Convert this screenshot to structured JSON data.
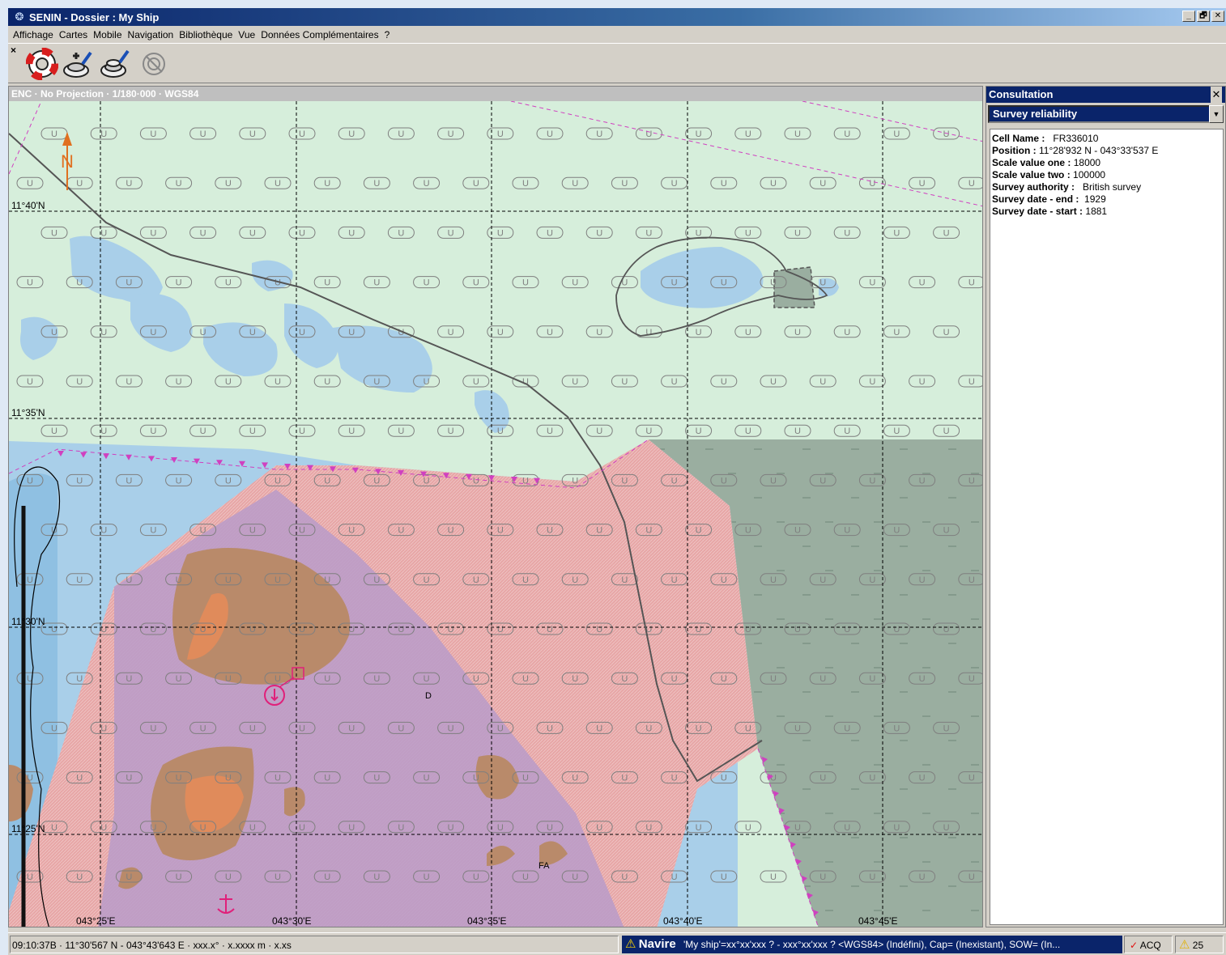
{
  "window": {
    "title": "SENIN - Dossier : My Ship",
    "minimize": "_",
    "restore": "🗗",
    "close": "✕"
  },
  "menu": [
    "Affichage",
    "Cartes",
    "Mobile",
    "Navigation",
    "Bibliothèque",
    "Vue",
    "Données Complémentaires",
    "?"
  ],
  "toolbar": {
    "close": "×",
    "buttons": [
      "lifebuoy-icon",
      "add-mobile-icon",
      "edit-mobile-icon",
      "disabled-mobile-icon"
    ]
  },
  "chart": {
    "header": "ENC  ·  No Projection  ·  1/180·000  ·  WGS84",
    "north_label": "N",
    "lat_labels": [
      "11°40'N",
      "11°35'N",
      "11°30'N",
      "11°25'N"
    ],
    "lon_labels": [
      "043°25'E",
      "043°30'E",
      "043°35'E",
      "043°40'E",
      "043°45'E"
    ],
    "zoc_symbol": "U",
    "small_labels": [
      "D",
      "FA"
    ],
    "colors": {
      "land_green": "#d6eedb",
      "shallow_blue": "#a9cfe9",
      "deep_blue": "#8fc0e2",
      "restricted_pink": "#e7a7a7",
      "restricted_purple": "#b99bc9",
      "land_brown": "#b98a6a",
      "land_orange": "#e08b5b",
      "grey_zone": "#9aaea0",
      "magenta": "#d040c0"
    }
  },
  "panel": {
    "title": "Consultation",
    "close": "✕",
    "selected": "Survey reliability",
    "rows": [
      {
        "label": "Cell Name :",
        "value": "FR336010"
      },
      {
        "label": "Position :",
        "value": "11°28'932 N - 043°33'537 E"
      },
      {
        "label": "Scale value one :",
        "value": "18000"
      },
      {
        "label": "Scale value two :",
        "value": "100000"
      },
      {
        "label": "Survey authority :",
        "value": "British survey"
      },
      {
        "label": "Survey date - end :",
        "value": "1929"
      },
      {
        "label": "Survey date - start :",
        "value": "1881"
      }
    ]
  },
  "status": {
    "left": "09:10:37B  ·  11°30'567 N - 043°43'643 E  ·  xxx.x°  ·  x.xxxx m  ·  x.xs",
    "nav_label": "Navire",
    "nav_text": "'My ship'=xx°xx'xxx ? - xxx°xx'xxx ? <WGS84> (Indéfini), Cap= (Inexistant), SOW= (In...",
    "acq_mark": "✓",
    "acq": "ACQ",
    "count": "25"
  }
}
